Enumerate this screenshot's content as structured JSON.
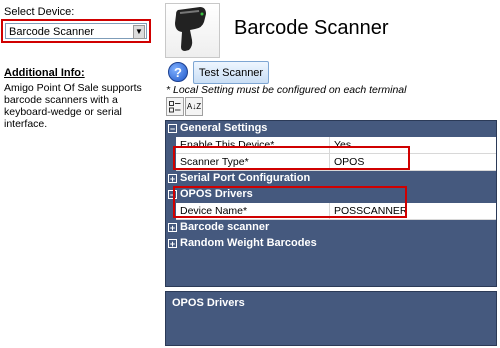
{
  "left": {
    "select_label": "Select Device:",
    "selected_device": "Barcode Scanner",
    "info_title": "Additional Info:",
    "info_text": "Amigo Point Of Sale supports barcode scanners with a keyboard-wedge or serial interface."
  },
  "header": {
    "device_title": "Barcode Scanner",
    "device_image_icon": "barcode-scanner-icon"
  },
  "actions": {
    "help_icon": "help-icon",
    "help_glyph": "?",
    "test_button": "Test Scanner",
    "note": "* Local Setting must be configured on each terminal"
  },
  "toolbar": {
    "categorized_icon": "categorized-icon",
    "alphabetical_icon": "sort-alphabetical-icon",
    "alphabetical_glyph": "A↓Z"
  },
  "property_grid": {
    "categories": [
      {
        "label": "General Settings",
        "expanded": true,
        "properties": [
          {
            "name": "Enable This Device*",
            "value": "Yes"
          },
          {
            "name": "Scanner Type*",
            "value": "OPOS"
          }
        ]
      },
      {
        "label": "Serial Port Configuration",
        "expanded": false,
        "properties": []
      },
      {
        "label": "OPOS Drivers",
        "expanded": true,
        "properties": [
          {
            "name": "Device Name*",
            "value": "POSSCANNER"
          }
        ]
      },
      {
        "label": "Barcode scanner",
        "expanded": false,
        "properties": []
      },
      {
        "label": "Random Weight Barcodes",
        "expanded": false,
        "properties": []
      }
    ],
    "toggle_expanded": "−",
    "toggle_collapsed": "+"
  },
  "description": {
    "title": "OPOS Drivers"
  },
  "colors": {
    "grid_header": "#45597e",
    "highlight": "#d00000",
    "button_top": "#eef6ff",
    "button_bottom": "#c9def5"
  }
}
